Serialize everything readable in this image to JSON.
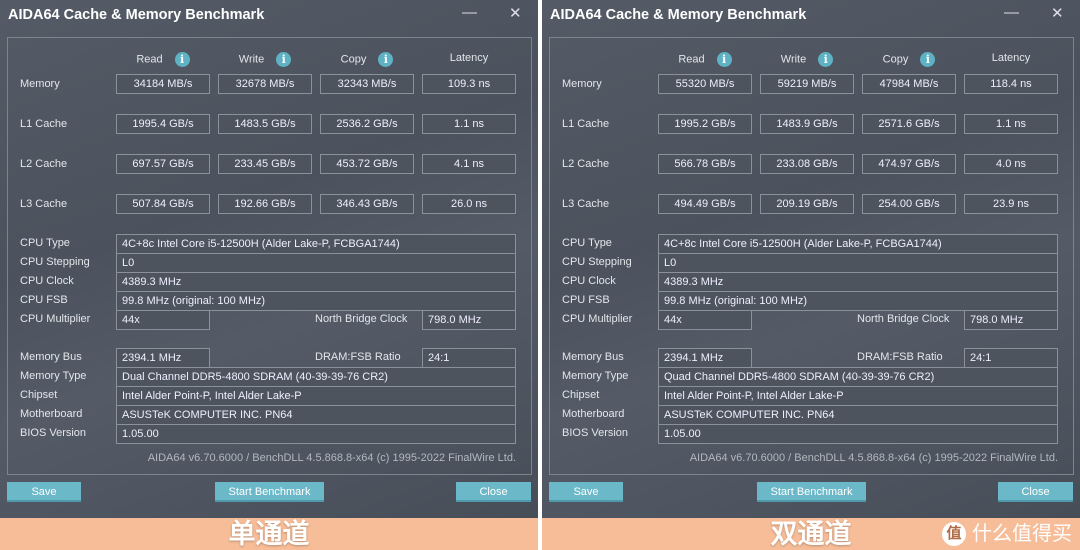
{
  "app_title": "AIDA64 Cache & Memory Benchmark",
  "columns": [
    "Read",
    "Write",
    "Copy",
    "Latency"
  ],
  "row_labels": [
    "Memory",
    "L1 Cache",
    "L2 Cache",
    "L3 Cache"
  ],
  "info_labels": {
    "cpu_type": "CPU Type",
    "cpu_stepping": "CPU Stepping",
    "cpu_clock": "CPU Clock",
    "cpu_fsb": "CPU FSB",
    "cpu_multiplier": "CPU Multiplier",
    "north_bridge_clock": "North Bridge Clock",
    "memory_bus": "Memory Bus",
    "dram_fsb_ratio": "DRAM:FSB Ratio",
    "memory_type": "Memory Type",
    "chipset": "Chipset",
    "motherboard": "Motherboard",
    "bios_version": "BIOS Version"
  },
  "buttons": {
    "save": "Save",
    "start": "Start Benchmark",
    "close": "Close"
  },
  "footer": "AIDA64 v6.70.6000 / BenchDLL 4.5.868.8-x64  (c) 1995-2022 FinalWire Ltd.",
  "watermark": "什么值得买",
  "watermark_logo": "值",
  "colors": {
    "accent": "#6bb8c8",
    "band": "#f6bd98"
  },
  "panels": [
    {
      "caption": "单通道",
      "results": [
        [
          "34184 MB/s",
          "32678 MB/s",
          "32343 MB/s",
          "109.3 ns"
        ],
        [
          "1995.4 GB/s",
          "1483.5 GB/s",
          "2536.2 GB/s",
          "1.1 ns"
        ],
        [
          "697.57 GB/s",
          "233.45 GB/s",
          "453.72 GB/s",
          "4.1 ns"
        ],
        [
          "507.84 GB/s",
          "192.66 GB/s",
          "346.43 GB/s",
          "26.0 ns"
        ]
      ],
      "info": {
        "cpu_type": "4C+8c Intel Core i5-12500H  (Alder Lake-P, FCBGA1744)",
        "cpu_stepping": "L0",
        "cpu_clock": "4389.3 MHz",
        "cpu_fsb": "99.8 MHz  (original: 100 MHz)",
        "cpu_multiplier": "44x",
        "north_bridge_clock": "798.0 MHz",
        "memory_bus": "2394.1 MHz",
        "dram_fsb_ratio": "24:1",
        "memory_type": "Dual Channel DDR5-4800 SDRAM  (40-39-39-76 CR2)",
        "chipset": "Intel Alder Point-P, Intel Alder Lake-P",
        "motherboard": "ASUSTeK COMPUTER INC. PN64",
        "bios_version": "1.05.00"
      }
    },
    {
      "caption": "双通道",
      "results": [
        [
          "55320 MB/s",
          "59219 MB/s",
          "47984 MB/s",
          "118.4 ns"
        ],
        [
          "1995.2 GB/s",
          "1483.9 GB/s",
          "2571.6 GB/s",
          "1.1 ns"
        ],
        [
          "566.78 GB/s",
          "233.08 GB/s",
          "474.97 GB/s",
          "4.0 ns"
        ],
        [
          "494.49 GB/s",
          "209.19 GB/s",
          "254.00 GB/s",
          "23.9 ns"
        ]
      ],
      "info": {
        "cpu_type": "4C+8c Intel Core i5-12500H  (Alder Lake-P, FCBGA1744)",
        "cpu_stepping": "L0",
        "cpu_clock": "4389.3 MHz",
        "cpu_fsb": "99.8 MHz  (original: 100 MHz)",
        "cpu_multiplier": "44x",
        "north_bridge_clock": "798.0 MHz",
        "memory_bus": "2394.1 MHz",
        "dram_fsb_ratio": "24:1",
        "memory_type": "Quad Channel DDR5-4800 SDRAM  (40-39-39-76 CR2)",
        "chipset": "Intel Alder Point-P, Intel Alder Lake-P",
        "motherboard": "ASUSTeK COMPUTER INC. PN64",
        "bios_version": "1.05.00"
      }
    }
  ]
}
